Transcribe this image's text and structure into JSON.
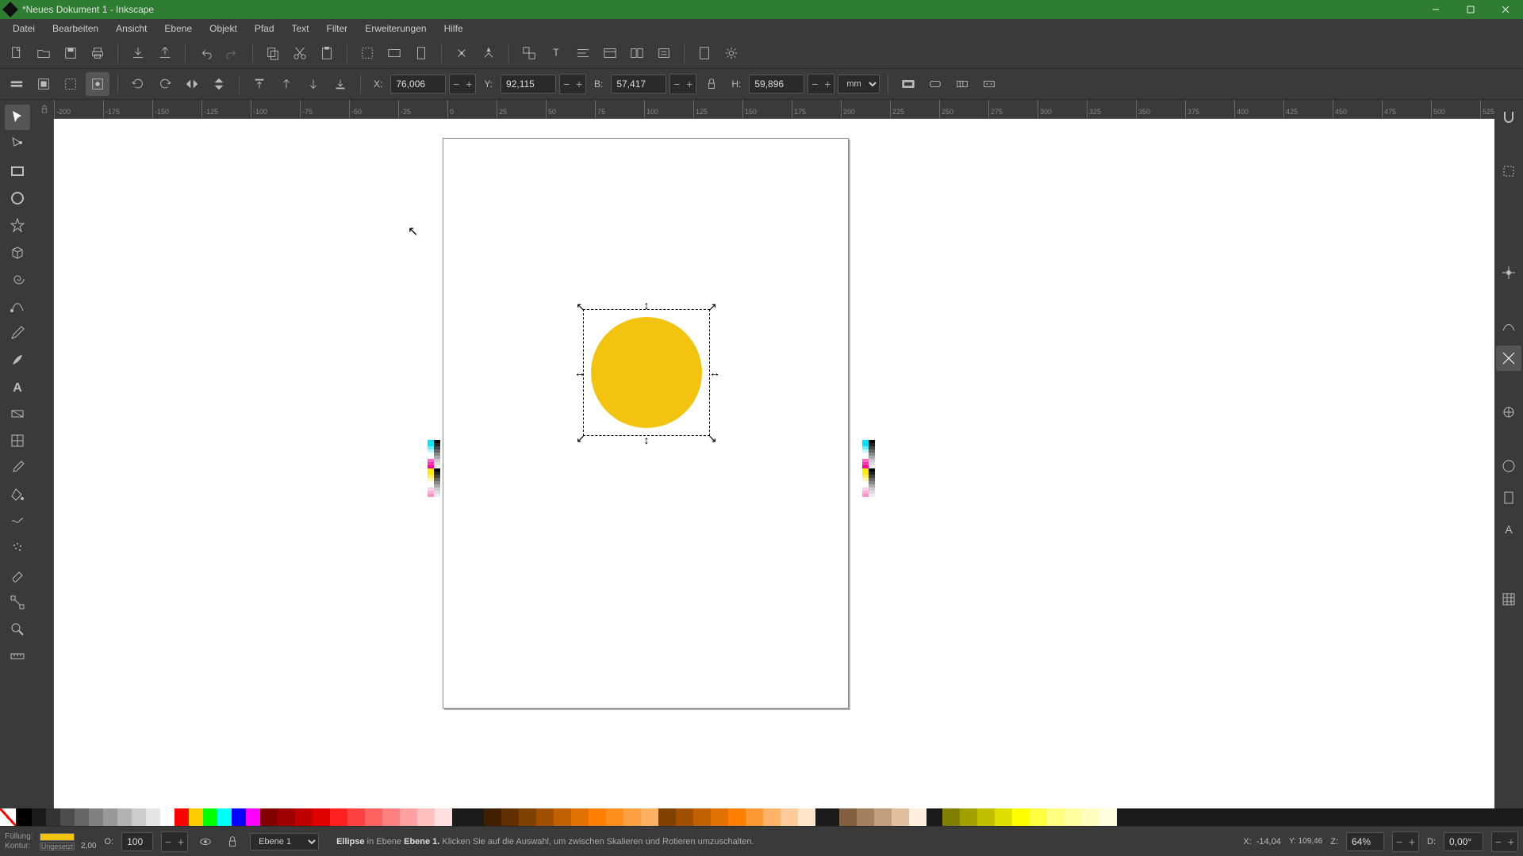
{
  "window": {
    "title": "*Neues Dokument 1 - Inkscape"
  },
  "menu": {
    "items": [
      "Datei",
      "Bearbeiten",
      "Ansicht",
      "Ebene",
      "Objekt",
      "Pfad",
      "Text",
      "Filter",
      "Erweiterungen",
      "Hilfe"
    ]
  },
  "coords": {
    "x_label": "X:",
    "x": "76,006",
    "y_label": "Y:",
    "y": "92,115",
    "w_label": "B:",
    "w": "57,417",
    "h_label": "H:",
    "h": "59,896",
    "unit": "mm"
  },
  "opacity": {
    "label": "O:",
    "value": "100"
  },
  "stroke_width": "2,00",
  "fill_label": "Füllung:",
  "stroke_label": "Kontur:",
  "stroke_value": "Ungesetzt",
  "layer": {
    "current": "Ebene 1"
  },
  "status": {
    "object": "Ellipse",
    "in_layer": " in Ebene ",
    "layer_name": "Ebene 1.",
    "hint": " Klicken Sie auf die Auswahl, um zwischen Skalieren und Rotieren umzuschalten."
  },
  "cursor_xy": {
    "x_label": "X:",
    "x": "-14,04",
    "y_label": "Y:",
    "y": "109,46"
  },
  "zoom": {
    "label": "Z:",
    "value": "64%"
  },
  "rotation": {
    "label": "D:",
    "value": "0,00°"
  },
  "ruler_h": [
    "-200",
    "-175",
    "-150",
    "-125",
    "-100",
    "-75",
    "-50",
    "-25",
    "0",
    "25",
    "50",
    "75",
    "100",
    "125",
    "150",
    "175",
    "200",
    "225",
    "250",
    "275",
    "300",
    "325",
    "350",
    "375",
    "400",
    "425",
    "450",
    "475",
    "500",
    "525"
  ],
  "colors": {
    "fill": "#f2c40f",
    "palette_grays": [
      "#000000",
      "#1a1a1a",
      "#333333",
      "#4d4d4d",
      "#666666",
      "#808080",
      "#999999",
      "#b3b3b3",
      "#cccccc",
      "#e6e6e6",
      "#ffffff"
    ],
    "palette_primaries": [
      "#ff0000",
      "#ffcc00",
      "#00ff00",
      "#00ffff",
      "#0000ff",
      "#ff00ff"
    ],
    "palette_reds": [
      "#800000",
      "#a00000",
      "#c00000",
      "#e00000",
      "#ff2020",
      "#ff4040",
      "#ff6060",
      "#ff8080",
      "#ffa0a0",
      "#ffc0c0",
      "#ffe0e0"
    ],
    "palette_browns": [
      "#402000",
      "#603000",
      "#804000",
      "#a05000",
      "#c06000",
      "#e07000",
      "#ff8000",
      "#ff9020",
      "#ffa040",
      "#ffb060"
    ],
    "palette_oranges": [
      "#804000",
      "#a05000",
      "#c06000",
      "#e07000",
      "#ff8000",
      "#ff9933",
      "#ffb366",
      "#ffcc99",
      "#ffe6cc"
    ],
    "palette_tans": [
      "#806040",
      "#a08060",
      "#c0a080",
      "#e0c0a0",
      "#fff0e0"
    ],
    "palette_yellows": [
      "#808000",
      "#a0a000",
      "#c0c000",
      "#e0e000",
      "#ffff00",
      "#ffff40",
      "#ffff80",
      "#ffffa0",
      "#ffffc0",
      "#ffffe0"
    ]
  }
}
